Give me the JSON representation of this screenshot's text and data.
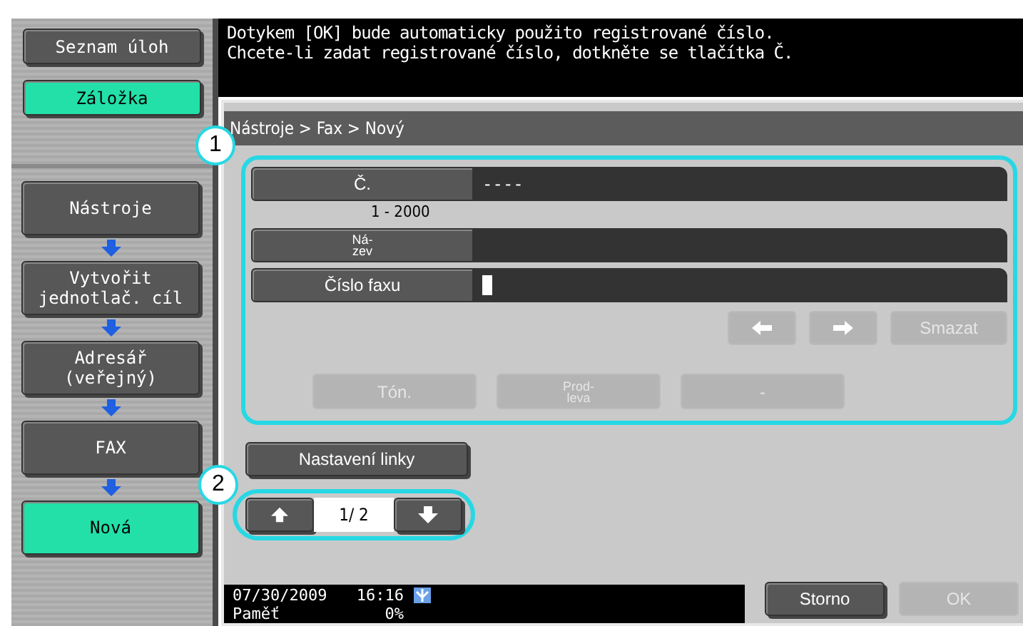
{
  "sidebar": {
    "top_buttons": [
      {
        "label": "Seznam úloh",
        "selected": false
      },
      {
        "label": "Záložka",
        "selected": true
      }
    ],
    "steps": [
      {
        "label": "Nástroje",
        "selected": false
      },
      {
        "label": "Vytvořit\njednotlač. cíl",
        "selected": false
      },
      {
        "label": "Adresář\n(veřejný)",
        "selected": false
      },
      {
        "label": "FAX",
        "selected": false
      },
      {
        "label": "Nová",
        "selected": true
      }
    ]
  },
  "message": [
    "Dotykem [OK] bude automaticky použito registrované číslo.",
    "Chcete-li zadat registrované číslo, dotkněte se tlačítka Č."
  ],
  "breadcrumb": "Nástroje > Fax > Nový",
  "callouts": [
    "1",
    "2"
  ],
  "fields": [
    {
      "label": "Č.",
      "value": "----",
      "hint": "1 - 2000",
      "cursor": false
    },
    {
      "label": "Ná-\nzev",
      "cursor": false
    },
    {
      "label": "Číslo faxu",
      "cursor": true
    }
  ],
  "edit_buttons": [
    {
      "kind": "left",
      "disabled": true
    },
    {
      "kind": "right",
      "disabled": true
    },
    {
      "kind": "text",
      "label": "Smazat",
      "disabled": true
    }
  ],
  "option_buttons": [
    {
      "label": "Tón.",
      "disabled": true
    },
    {
      "label": "Prod-\nleva",
      "disabled": true
    },
    {
      "label": "-",
      "disabled": true
    }
  ],
  "line_settings": {
    "label": "Nastavení linky"
  },
  "pager": {
    "page": "1/ 2"
  },
  "status": {
    "date": "07/30/2009",
    "time": "16:16",
    "memory_label": "Paměť",
    "memory": "0%"
  },
  "footer_buttons": [
    {
      "label": "Storno",
      "disabled": false
    },
    {
      "label": "OK",
      "disabled": true
    }
  ]
}
